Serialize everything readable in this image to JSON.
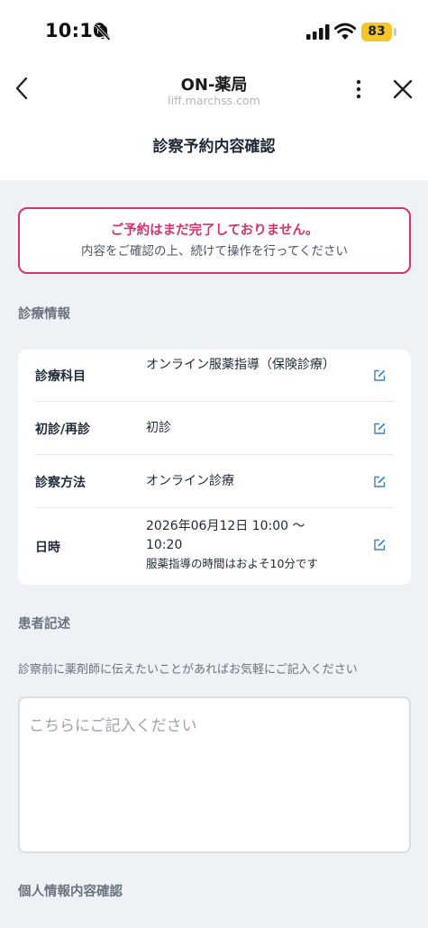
{
  "status_bar": {
    "time": "10:10",
    "battery": "83"
  },
  "nav": {
    "title": "ON-薬局",
    "subtitle": "liff.marchss.com"
  },
  "page_title": "診察予約内容確認",
  "alert": {
    "title": "ご予約はまだ完了しておりません。",
    "body": "内容をご確認の上、続けて操作を行ってください"
  },
  "sections": {
    "medical_info": "診療情報",
    "patient_notes": "患者記述",
    "personal_info": "個人情報内容確認"
  },
  "medical_rows": [
    {
      "label": "診療科目",
      "value": "オンライン服薬指導（保険診療）"
    },
    {
      "label": "初診/再診",
      "value": "初診"
    },
    {
      "label": "診察方法",
      "value": "オンライン診療"
    },
    {
      "label": "日時",
      "value": "2026年06月12日 10:00 〜 10:20",
      "note": "服薬指導の時間はおよそ10分です"
    }
  ],
  "notes": {
    "hint": "診察前に薬剤師に伝えたいことがあればお気軽にご記入ください",
    "placeholder": "こちらにご記入ください"
  },
  "colors": {
    "accent": "#d6336c",
    "edit_icon": "#3b82c4",
    "battery": "#f4c628"
  }
}
